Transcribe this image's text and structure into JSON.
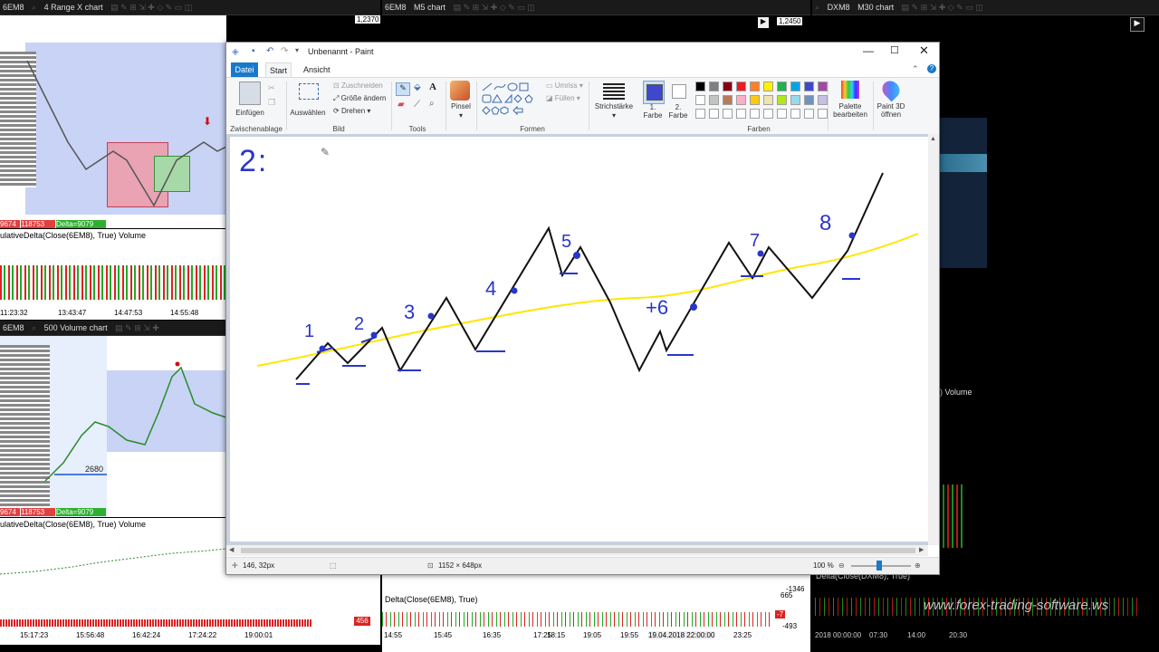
{
  "charts": {
    "tl": {
      "symbol": "6EM8",
      "type": "4 Range X chart",
      "price": "1,2370",
      "delta_left": "9674",
      "delta_mid": "118753",
      "delta": "Delta=9079",
      "indicator": "ulativeDelta(Close(6EM8), True) Volume",
      "times": [
        "11:23:32",
        "13:43:47",
        "14:47:53",
        "14:55:48"
      ]
    },
    "ml": {
      "symbol": "6EM8",
      "type": "500 Volume chart",
      "poc_value": "2680",
      "delta_left": "9674",
      "delta_mid": "118753",
      "delta": "Delta=9079",
      "indicator": "ulativeDelta(Close(6EM8), True) Volume",
      "times": [
        "15:17:23",
        "15:56:48",
        "16:42:24",
        "17:24:22",
        "19:00:01"
      ],
      "badge": "456"
    },
    "mid": {
      "symbol": "6EM8",
      "type": "M5 chart",
      "price": "1,2450",
      "indicator": "Delta(Close(6EM8), True)",
      "right_values": [
        "-1346",
        "665",
        "-7",
        "-493"
      ],
      "times": [
        "14:55",
        "15:45",
        "16:35",
        "17:25",
        "18:15",
        "19:05",
        "19:55",
        "19.04.2018 22:00:00",
        "23:25"
      ]
    },
    "right": {
      "symbol": "DXM8",
      "type": "M30 chart",
      "vol_label": ") Volume",
      "indicator": "Delta(Close(DXM8), True)",
      "times": [
        "2018 00:00:00",
        "07:30",
        "14:00",
        "20:30"
      ],
      "watermark": "www.forex-trading-software.ws"
    }
  },
  "paint": {
    "title": "Unbenannt - Paint",
    "tabs": {
      "file": "Datei",
      "start": "Start",
      "view": "Ansicht"
    },
    "ribbon": {
      "clipboard": {
        "paste": "Einfügen",
        "label": "Zwischenablage"
      },
      "image": {
        "select": "Auswählen",
        "crop": "Zuschneiden",
        "resize": "Größe ändern",
        "rotate": "Drehen",
        "label": "Bild"
      },
      "tools": {
        "label": "Tools"
      },
      "brushes": {
        "label": "Pinsel"
      },
      "shapes": {
        "outline": "Umriss",
        "fill": "Füllen",
        "label": "Formen"
      },
      "size": {
        "label": "Strichstärke"
      },
      "color1": {
        "label1": "1.",
        "label2": "Farbe"
      },
      "color2": {
        "label1": "2.",
        "label2": "Farbe"
      },
      "colors": {
        "label": "Farben"
      },
      "edit_colors": {
        "label1": "Palette",
        "label2": "bearbeiten"
      },
      "paint3d": {
        "label1": "Paint 3D",
        "label2": "öffnen"
      }
    },
    "palette": [
      "#000000",
      "#7f7f7f",
      "#880015",
      "#ed1c24",
      "#ff7f27",
      "#fff200",
      "#22b14c",
      "#00a2e8",
      "#3f48cc",
      "#a349a4",
      "#ffffff",
      "#c3c3c3",
      "#b97a57",
      "#ffaec9",
      "#ffc90e",
      "#efe4b0",
      "#b5e61d",
      "#99d9ea",
      "#7092be",
      "#c8bfe7"
    ],
    "color1": "#3f48cc",
    "color2": "#ffffff",
    "drawing": {
      "heading": "2:",
      "labels": [
        "1",
        "2",
        "3",
        "4",
        "5",
        "6",
        "7",
        "8"
      ],
      "label_six": "+6"
    },
    "status": {
      "cursor": "146, 32px",
      "size": "1152 × 648px",
      "zoom": "100 %"
    }
  }
}
